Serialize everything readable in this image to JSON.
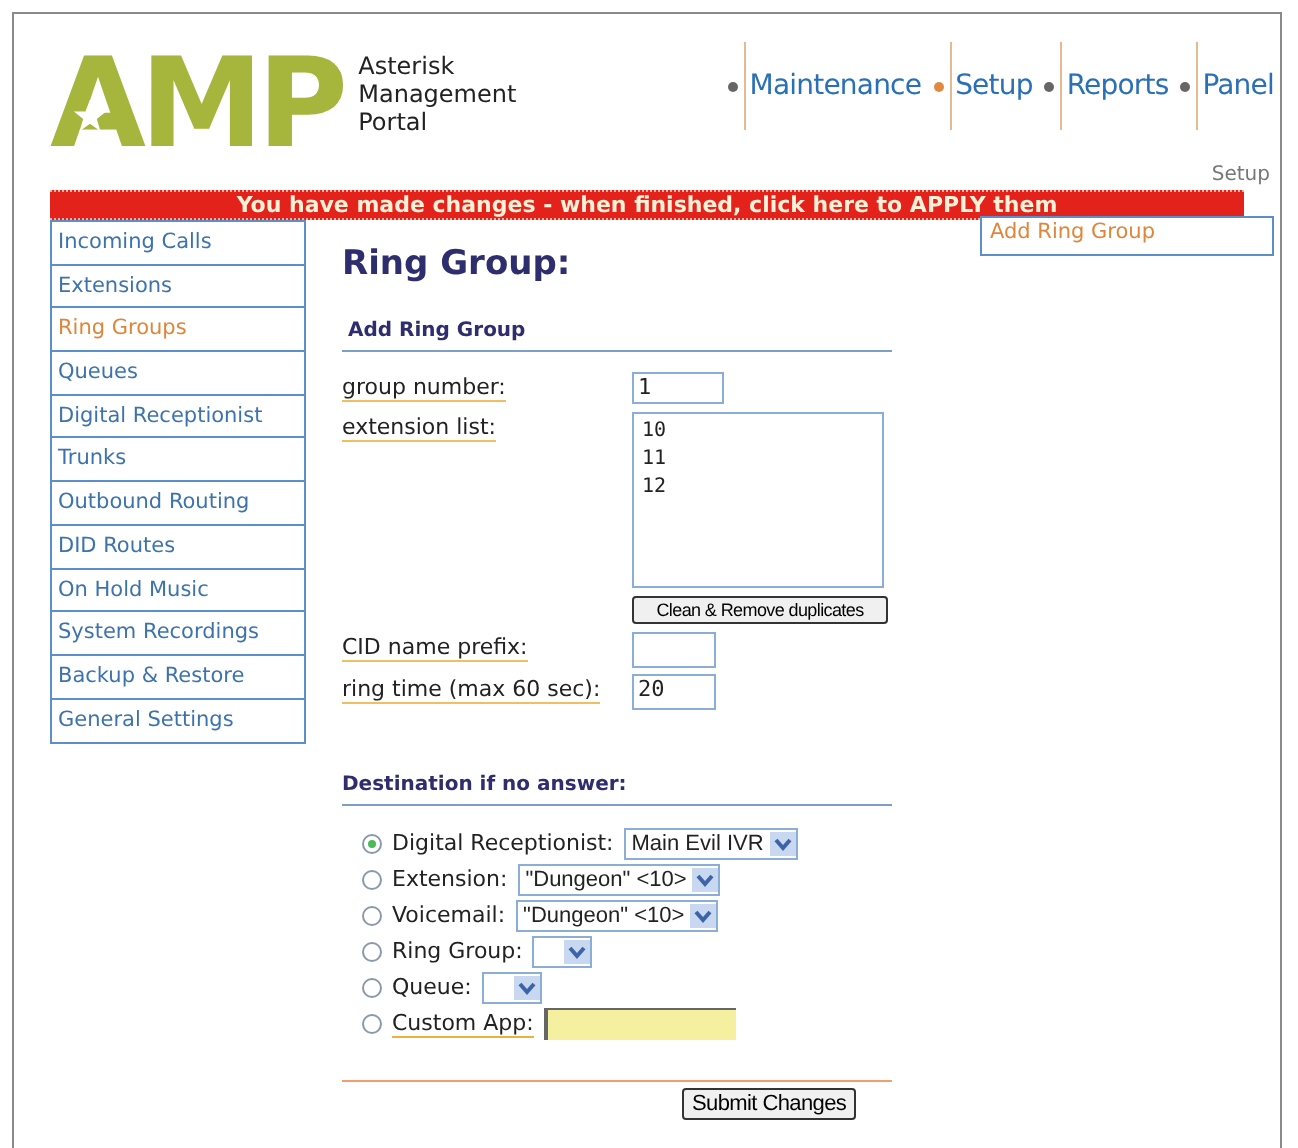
{
  "logo": {
    "text": "AMP",
    "subtitle": [
      "Asterisk",
      "Management",
      "Portal"
    ]
  },
  "nav": [
    {
      "label": "Maintenance",
      "selected": false
    },
    {
      "label": "Setup",
      "selected": true
    },
    {
      "label": "Reports",
      "selected": false
    },
    {
      "label": "Panel",
      "selected": false
    }
  ],
  "breadcrumb": "Setup",
  "apply_banner": "You have made changes - when finished, click here to APPLY them",
  "sidebar": {
    "items": [
      {
        "label": "Incoming Calls",
        "selected": false
      },
      {
        "label": "Extensions",
        "selected": false
      },
      {
        "label": "Ring Groups",
        "selected": true
      },
      {
        "label": "Queues",
        "selected": false
      },
      {
        "label": "Digital Receptionist",
        "selected": false
      },
      {
        "label": "Trunks",
        "selected": false
      },
      {
        "label": "Outbound Routing",
        "selected": false
      },
      {
        "label": "DID Routes",
        "selected": false
      },
      {
        "label": "On Hold Music",
        "selected": false
      },
      {
        "label": "System Recordings",
        "selected": false
      },
      {
        "label": "Backup & Restore",
        "selected": false
      },
      {
        "label": "General Settings",
        "selected": false
      }
    ]
  },
  "right_menu": {
    "items": [
      {
        "label": "Add Ring Group",
        "selected": true
      }
    ]
  },
  "page_title": "Ring Group:",
  "section_title": "Add Ring Group",
  "group_number": {
    "label": "group number:",
    "value": "1"
  },
  "extension_list": {
    "label": "extension list:",
    "lines": [
      "10",
      "11",
      "12"
    ]
  },
  "clean_button": "Clean & Remove duplicates",
  "cid_prefix": {
    "label": "CID name prefix:"
  },
  "ring_time": {
    "label": "ring time (max 60 sec):",
    "value": "20"
  },
  "destination": {
    "title": "Destination if no answer:",
    "options": [
      {
        "label": "Digital Receptionist:",
        "selected": true,
        "kind": "select",
        "value": "Main Evil IVR"
      },
      {
        "label": "Extension:",
        "selected": false,
        "kind": "select",
        "value": "\"Dungeon\" <10>"
      },
      {
        "label": "Voicemail:",
        "selected": false,
        "kind": "select",
        "value": "\"Dungeon\" <10>"
      },
      {
        "label": "Ring Group:",
        "selected": false,
        "kind": "select"
      },
      {
        "label": "Queue:",
        "selected": false,
        "kind": "select"
      },
      {
        "label": "Custom App:",
        "selected": false,
        "kind": "text"
      }
    ]
  },
  "submit_button": "Submit Changes"
}
